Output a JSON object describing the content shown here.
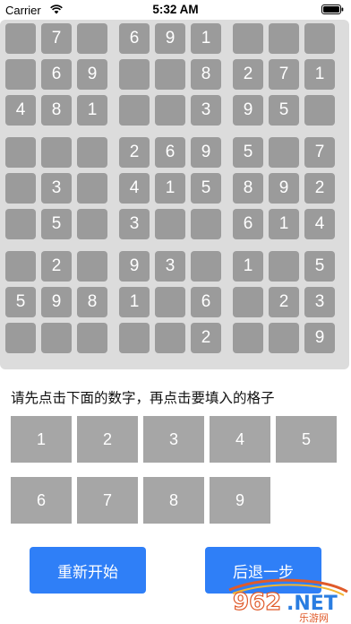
{
  "status_bar": {
    "carrier": "Carrier",
    "time": "5:32 AM"
  },
  "board": {
    "rows": [
      [
        "",
        "7",
        "",
        "6",
        "9",
        "1",
        "",
        "",
        ""
      ],
      [
        "",
        "6",
        "9",
        "",
        "",
        "8",
        "2",
        "7",
        "1"
      ],
      [
        "4",
        "8",
        "1",
        "",
        "",
        "3",
        "9",
        "5",
        ""
      ],
      [
        "",
        "",
        "",
        "2",
        "6",
        "9",
        "5",
        "",
        "7"
      ],
      [
        "",
        "3",
        "",
        "4",
        "1",
        "5",
        "8",
        "9",
        "2"
      ],
      [
        "",
        "5",
        "",
        "3",
        "",
        "",
        "6",
        "1",
        "4"
      ],
      [
        "",
        "2",
        "",
        "9",
        "3",
        "",
        "1",
        "",
        "5"
      ],
      [
        "5",
        "9",
        "8",
        "1",
        "",
        "6",
        "",
        "2",
        "3"
      ],
      [
        "",
        "",
        "",
        "",
        "",
        "2",
        "",
        "",
        "9"
      ]
    ]
  },
  "instruction": "请先点击下面的数字，再点击要填入的格子",
  "numbers": [
    "1",
    "2",
    "3",
    "4",
    "5",
    "6",
    "7",
    "8",
    "9"
  ],
  "actions": {
    "restart": "重新开始",
    "undo": "后退一步"
  },
  "watermark": {
    "brand": "962.NET",
    "sub": "乐游网"
  },
  "colors": {
    "board_bg": "#dcdcdc",
    "cell_bg": "#9b9b9b",
    "number_button_bg": "#a6a6a6",
    "action_button_bg": "#2f7ff7"
  }
}
